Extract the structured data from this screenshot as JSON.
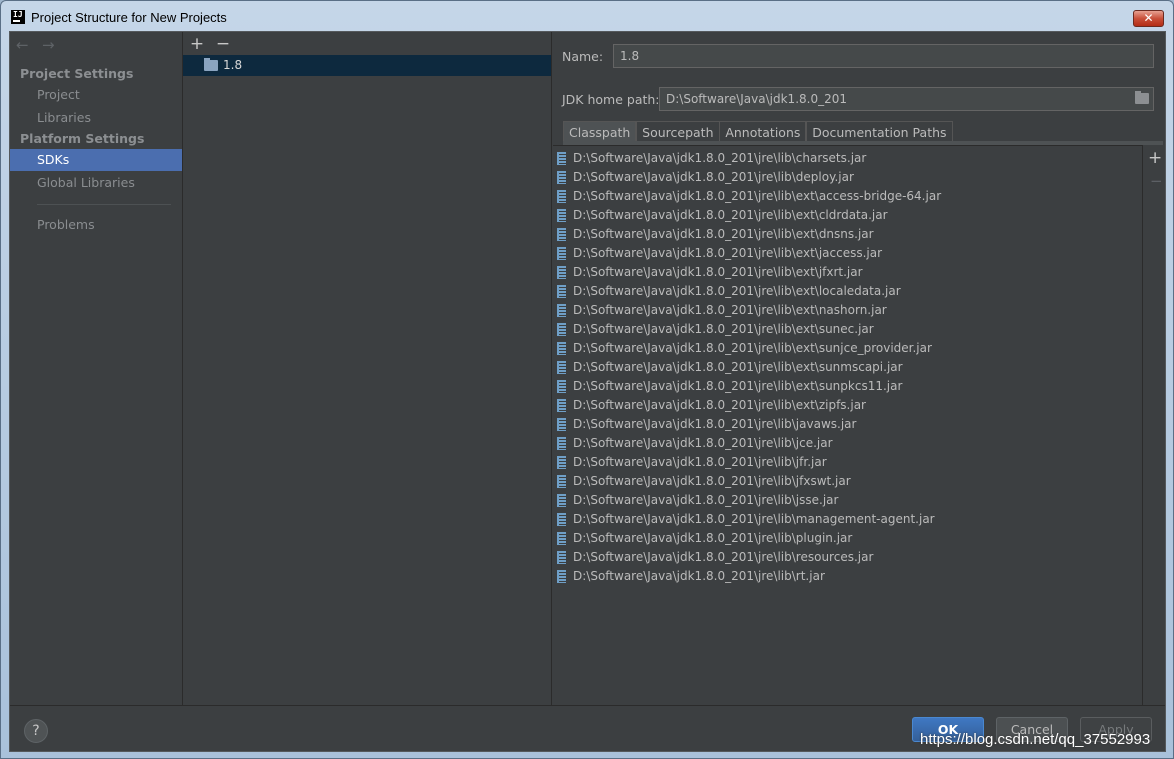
{
  "window": {
    "title": "Project Structure for New Projects",
    "close_label": "✕"
  },
  "nav": {
    "back_icon": "←",
    "forward_icon": "→",
    "sections": [
      {
        "title": "Project Settings",
        "items": [
          "Project",
          "Libraries"
        ]
      },
      {
        "title": "Platform Settings",
        "items": [
          "SDKs",
          "Global Libraries"
        ]
      }
    ],
    "problems": "Problems",
    "selected": "SDKs"
  },
  "sdk_list": {
    "add_label": "+",
    "remove_label": "−",
    "items": [
      {
        "name": "1.8",
        "selected": true
      }
    ]
  },
  "detail": {
    "name_label": "Name:",
    "name_value": "1.8",
    "home_label": "JDK home path:",
    "home_value": "D:\\Software\\Java\\jdk1.8.0_201",
    "tabs": [
      "Classpath",
      "Sourcepath",
      "Annotations",
      "Documentation Paths"
    ],
    "active_tab": "Classpath",
    "paths": [
      "D:\\Software\\Java\\jdk1.8.0_201\\jre\\lib\\charsets.jar",
      "D:\\Software\\Java\\jdk1.8.0_201\\jre\\lib\\deploy.jar",
      "D:\\Software\\Java\\jdk1.8.0_201\\jre\\lib\\ext\\access-bridge-64.jar",
      "D:\\Software\\Java\\jdk1.8.0_201\\jre\\lib\\ext\\cldrdata.jar",
      "D:\\Software\\Java\\jdk1.8.0_201\\jre\\lib\\ext\\dnsns.jar",
      "D:\\Software\\Java\\jdk1.8.0_201\\jre\\lib\\ext\\jaccess.jar",
      "D:\\Software\\Java\\jdk1.8.0_201\\jre\\lib\\ext\\jfxrt.jar",
      "D:\\Software\\Java\\jdk1.8.0_201\\jre\\lib\\ext\\localedata.jar",
      "D:\\Software\\Java\\jdk1.8.0_201\\jre\\lib\\ext\\nashorn.jar",
      "D:\\Software\\Java\\jdk1.8.0_201\\jre\\lib\\ext\\sunec.jar",
      "D:\\Software\\Java\\jdk1.8.0_201\\jre\\lib\\ext\\sunjce_provider.jar",
      "D:\\Software\\Java\\jdk1.8.0_201\\jre\\lib\\ext\\sunmscapi.jar",
      "D:\\Software\\Java\\jdk1.8.0_201\\jre\\lib\\ext\\sunpkcs11.jar",
      "D:\\Software\\Java\\jdk1.8.0_201\\jre\\lib\\ext\\zipfs.jar",
      "D:\\Software\\Java\\jdk1.8.0_201\\jre\\lib\\javaws.jar",
      "D:\\Software\\Java\\jdk1.8.0_201\\jre\\lib\\jce.jar",
      "D:\\Software\\Java\\jdk1.8.0_201\\jre\\lib\\jfr.jar",
      "D:\\Software\\Java\\jdk1.8.0_201\\jre\\lib\\jfxswt.jar",
      "D:\\Software\\Java\\jdk1.8.0_201\\jre\\lib\\jsse.jar",
      "D:\\Software\\Java\\jdk1.8.0_201\\jre\\lib\\management-agent.jar",
      "D:\\Software\\Java\\jdk1.8.0_201\\jre\\lib\\plugin.jar",
      "D:\\Software\\Java\\jdk1.8.0_201\\jre\\lib\\resources.jar",
      "D:\\Software\\Java\\jdk1.8.0_201\\jre\\lib\\rt.jar"
    ],
    "list_add_label": "+",
    "list_remove_label": "−"
  },
  "buttons": {
    "help": "?",
    "ok": "OK",
    "cancel": "Cancel",
    "apply": "Apply"
  },
  "watermark": "https://blog.csdn.net/qq_37552993",
  "colors": {
    "selection": "#4b6eaf",
    "background": "#3c3f41",
    "primary_button": "#365f9c"
  }
}
